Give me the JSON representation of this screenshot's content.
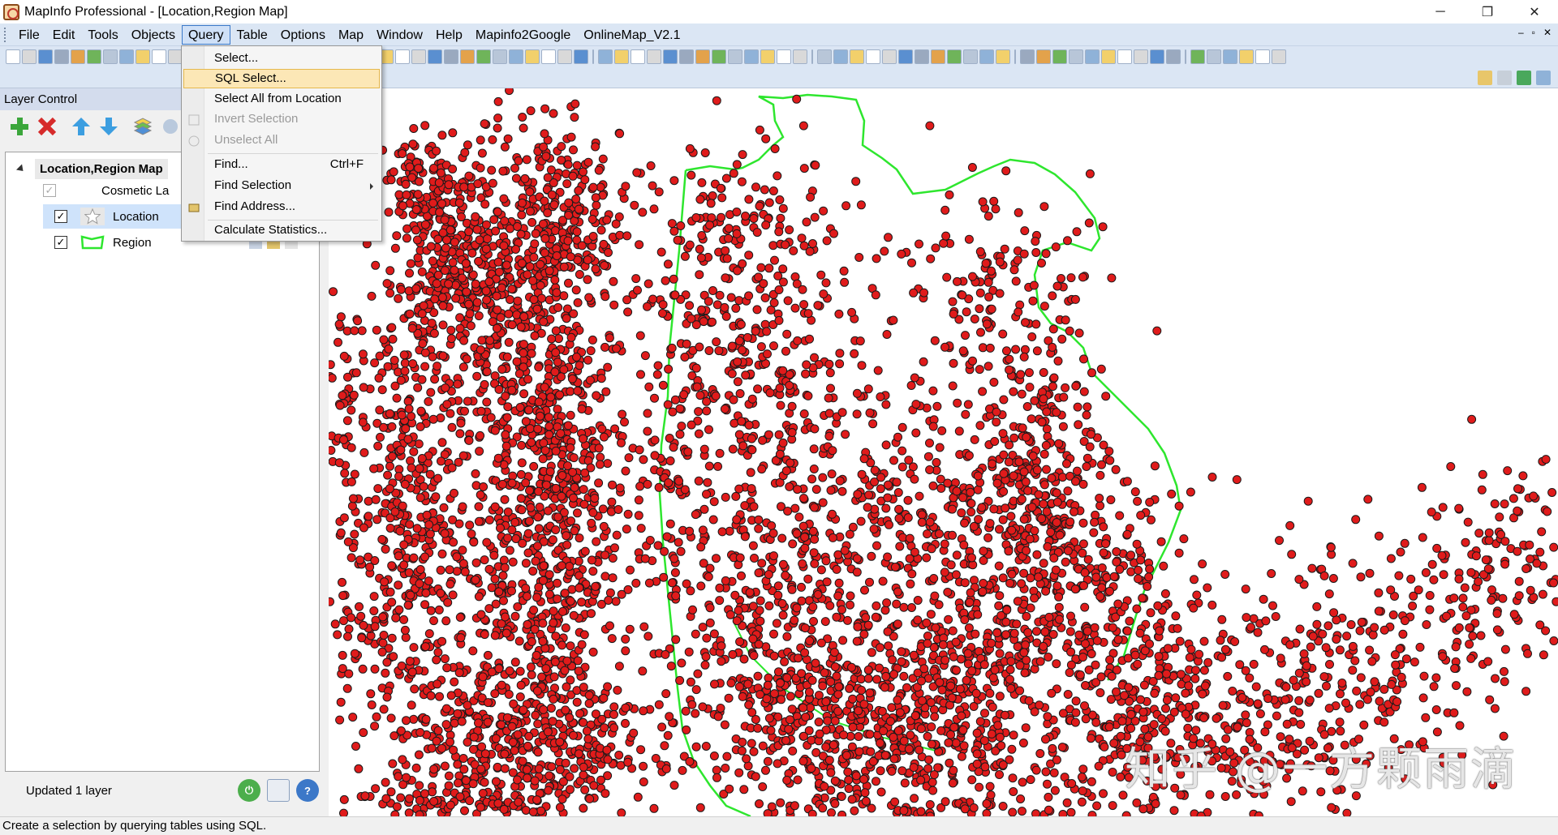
{
  "window": {
    "title": "MapInfo Professional - [Location,Region Map]",
    "controls": [
      "─",
      "❐",
      "✕"
    ]
  },
  "menubar": {
    "items": [
      "File",
      "Edit",
      "Tools",
      "Objects",
      "Query",
      "Table",
      "Options",
      "Map",
      "Window",
      "Help",
      "Mapinfo2Google",
      "OnlineMap_V2.1"
    ],
    "active": "Query",
    "mdi_controls": [
      "–",
      "▫",
      "✕"
    ]
  },
  "query_menu": {
    "items": [
      {
        "label": "Select...",
        "shortcut": "",
        "state": "normal"
      },
      {
        "label": "SQL Select...",
        "shortcut": "",
        "state": "hover"
      },
      {
        "label": "Select All from Location",
        "shortcut": "",
        "state": "normal"
      },
      {
        "label": "Invert Selection",
        "shortcut": "",
        "state": "disabled"
      },
      {
        "label": "Unselect All",
        "shortcut": "",
        "state": "disabled"
      },
      {
        "label": "Find...",
        "shortcut": "Ctrl+F",
        "state": "normal"
      },
      {
        "label": "Find Selection",
        "shortcut": "",
        "state": "submenu"
      },
      {
        "label": "Find Address...",
        "shortcut": "",
        "state": "normal"
      },
      {
        "label": "Calculate Statistics...",
        "shortcut": "",
        "state": "normal"
      }
    ]
  },
  "layer_control": {
    "header": "Layer Control",
    "map_name": "Location,Region Map",
    "layers": [
      {
        "name": "Cosmetic La",
        "checked": true,
        "disabled": true
      },
      {
        "name": "Location",
        "checked": true,
        "selected": true
      },
      {
        "name": "Region",
        "checked": true
      }
    ],
    "status": "Updated 1 layer"
  },
  "map": {
    "point_color": "#e01b1b",
    "point_outline": "#1a1a1a",
    "boundary_color": "#2ee62e",
    "watermark": "知乎 @一方颗雨滴"
  },
  "statusbar": {
    "text": "Create a selection by querying tables using SQL."
  }
}
